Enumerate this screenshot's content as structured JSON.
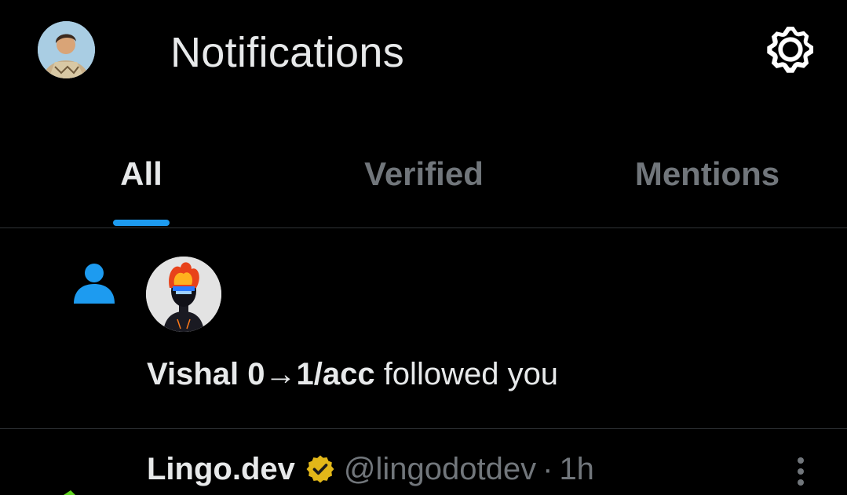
{
  "header": {
    "title": "Notifications",
    "avatar_icon": "user-avatar",
    "settings_icon": "gear-icon"
  },
  "tabs": [
    {
      "label": "All",
      "active": true
    },
    {
      "label": "Verified",
      "active": false
    },
    {
      "label": "Mentions",
      "active": false
    }
  ],
  "notifications": [
    {
      "type": "follow",
      "icon": "person-icon",
      "actor_name": "Vishal 0→1/acc",
      "action_text": " followed you"
    }
  ],
  "post": {
    "name": "Lingo.dev",
    "verified_badge": "verified-badge-icon",
    "handle": "@lingodotdev",
    "separator": "·",
    "time": "1h",
    "more_icon": "more-vertical-icon"
  },
  "colors": {
    "background": "#000000",
    "text_primary": "#e7e9ea",
    "text_secondary": "#71767b",
    "accent": "#1d9bf0",
    "divider": "#2f3336",
    "badge_gold": "#e2b719"
  }
}
